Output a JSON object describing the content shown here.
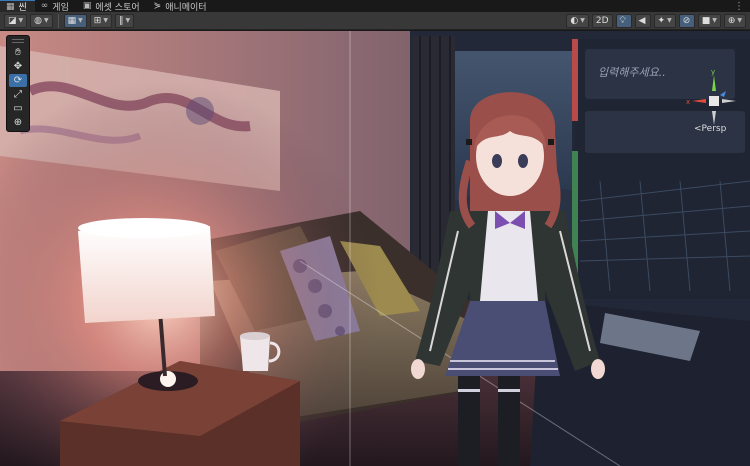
{
  "tabs": [
    {
      "label": "씬",
      "icon": "grid-icon",
      "active": true
    },
    {
      "label": "게임",
      "icon": "gamepad-icon",
      "active": false
    },
    {
      "label": "에셋 스토어",
      "icon": "store-icon",
      "active": false
    },
    {
      "label": "애니메이터",
      "icon": "animator-icon",
      "active": false
    }
  ],
  "toolbar": {
    "mode_2d": "2D",
    "accent": "#46607c"
  },
  "viewport": {
    "screen_text": "입력해주세요..",
    "projection": "Persp",
    "gizmo": {
      "x": "x",
      "y": "y",
      "y_color": "#7bd34a",
      "x_color": "#e04b3b",
      "z_color": "#4a8be0"
    }
  },
  "colors": {
    "tab_accent": "#3a79bb",
    "toolbar_bg": "#383838",
    "active_tool": "#3b6fa8"
  }
}
